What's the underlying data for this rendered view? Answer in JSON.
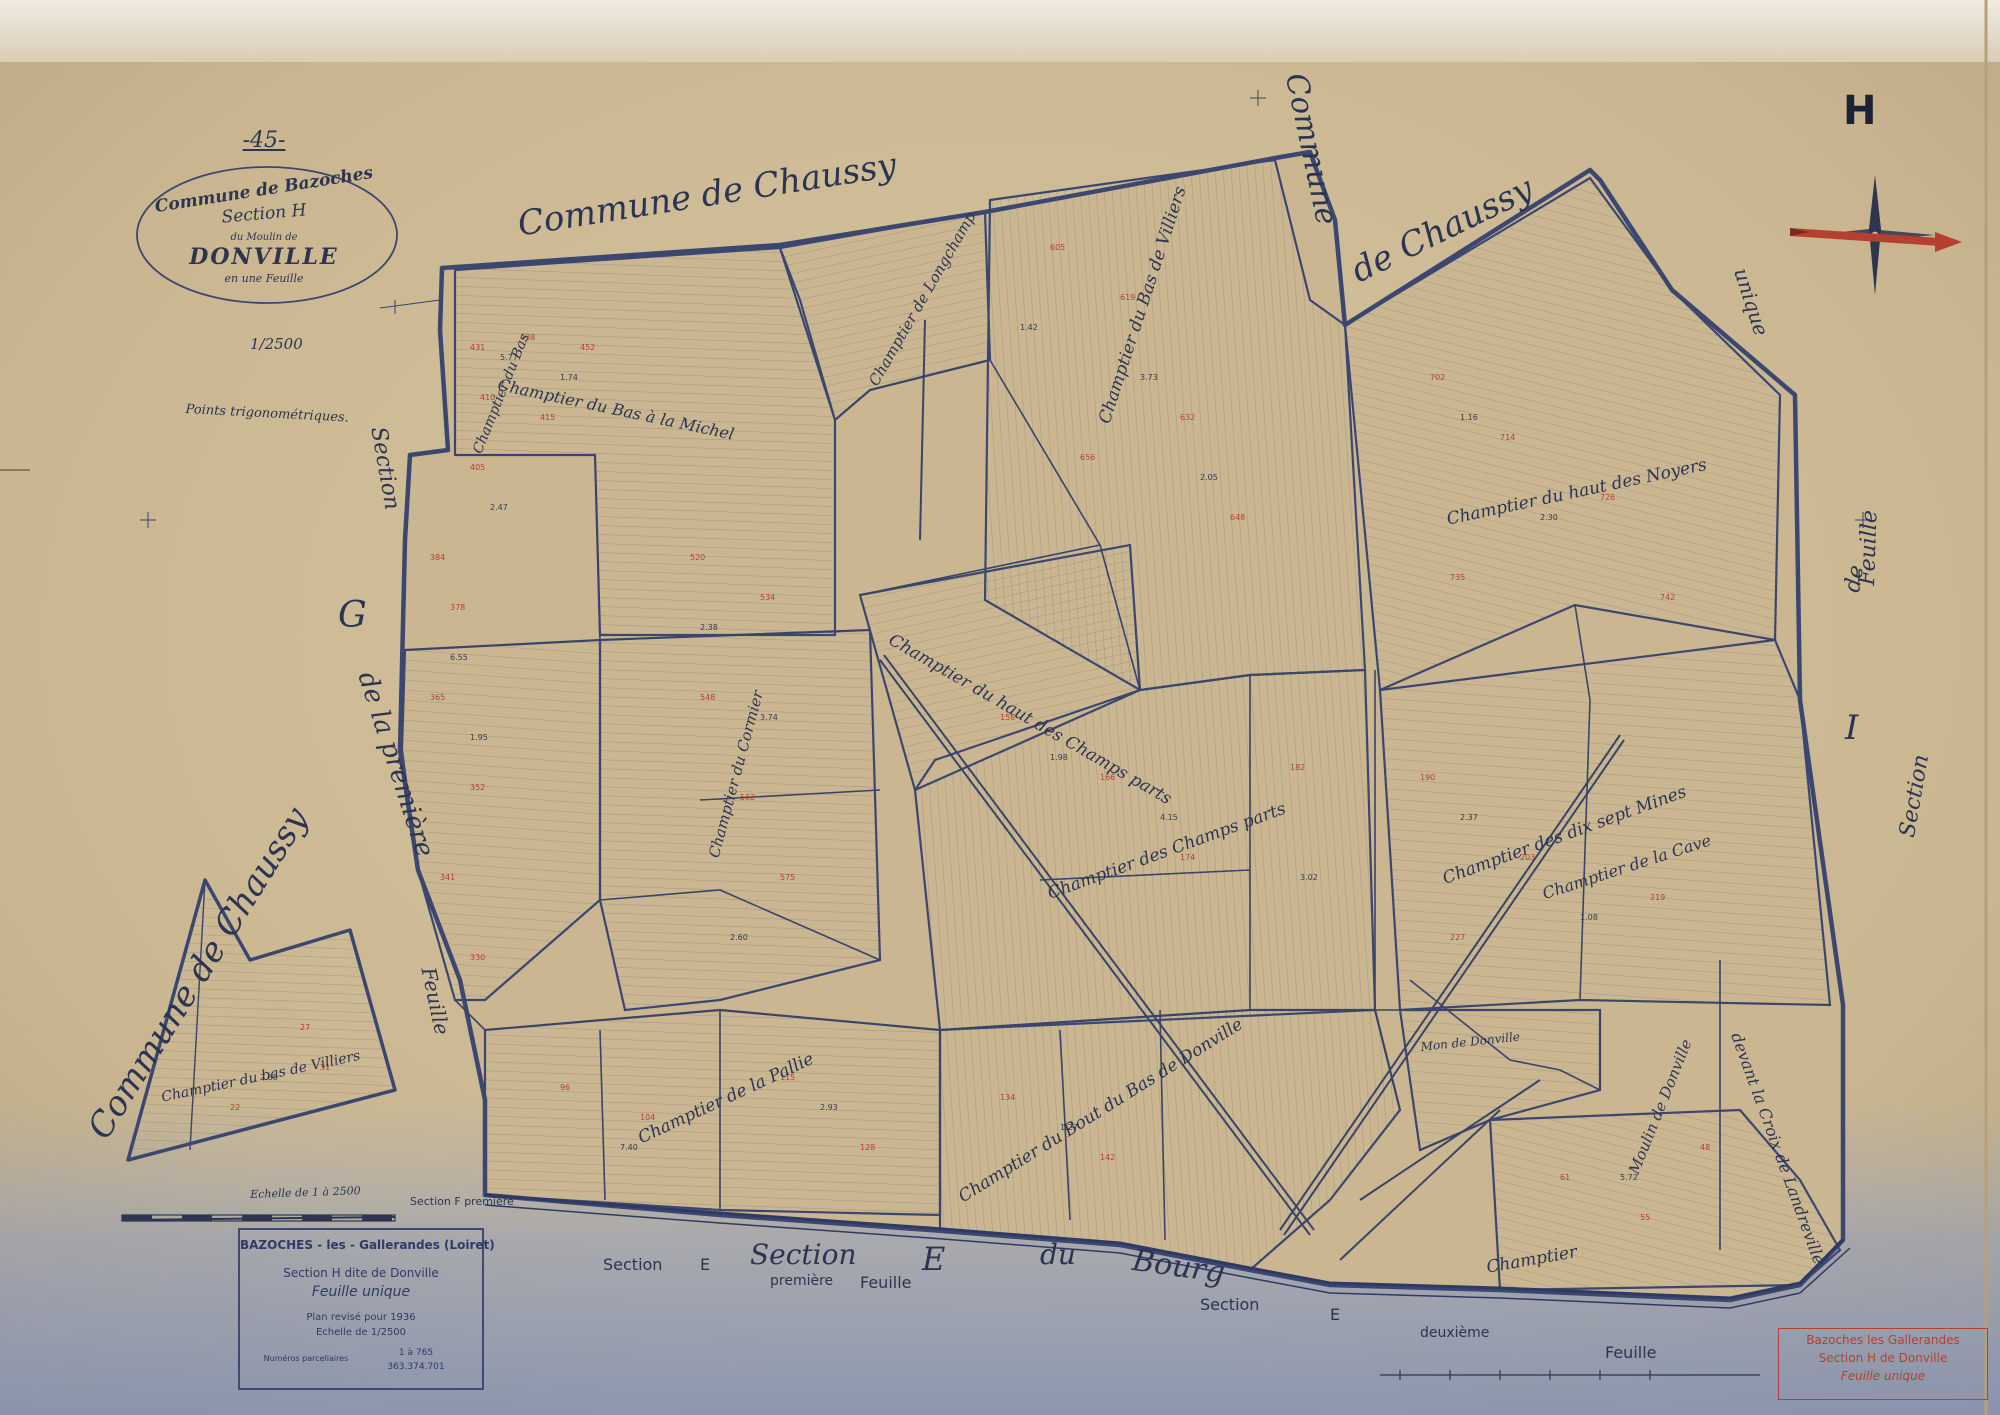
{
  "sheet": {
    "section_letter": "H",
    "sheet_number": "-45-",
    "cartouche": {
      "line1": "Commune de Bazoches",
      "line2": "Section H",
      "line3": "du Moulin de",
      "line4": "DONVILLE",
      "line5": "en une Feuille"
    },
    "scale_fraction": "1/2500",
    "trig_points": "Points trigonométriques."
  },
  "neighbours": {
    "north_left": "Commune de Chaussy",
    "north_vertical": "Commune",
    "north_right": "de Chaussy",
    "west_inset": "Commune de Chaussy",
    "west_section": "Section",
    "west_letter": "G",
    "west_premiere": "de la première",
    "west_feuille": "Feuille",
    "east_section": "Section",
    "east_letter": "I",
    "east_de": "de",
    "east_feuille": "Feuille",
    "east_unique": "unique",
    "south_section_label": "Section",
    "south_letter": "E",
    "south_section_italic": "Section",
    "south_premiere": "première",
    "south_feuille": "Feuille",
    "south_du": "du",
    "south_bourg": "Bourg",
    "south_section2": "Section",
    "south_letter2": "E",
    "south_deuxieme": "deuxième",
    "south_feuille2": "Feuille",
    "scale_bar_label": "Echelle de 1 à 2500",
    "section_f": "Section F première"
  },
  "champtiers": [
    "Champtier du Bas à la Michel",
    "Champtier du Bas",
    "Champtier de Longchamp",
    "Champtier du Bas de Villiers",
    "Champtier du haut des Noyers",
    "Champtier du haut des Champs parts",
    "Champtier du Cormier",
    "Champtier des Champs parts",
    "Champtier des dix sept Mines",
    "Champtier de la Cave",
    "Champtier de la Pallie",
    "Champtier du Bout du Bas de Donville",
    "Champtier du bas de Villiers",
    "Champtier",
    "Mon de Donville",
    "Moulin de Donville",
    "devant la Croix de Landreville"
  ],
  "legend": {
    "title": "BAZOCHES - les - Gallerandes (Loiret)",
    "section": "Section H dite de Donville",
    "feuille": "Feuille unique",
    "plan": "Plan revisé pour 1936",
    "echelle_label": "Echelle de",
    "echelle_value": "1/2500",
    "numeros": "Numéros parcellaires",
    "n1": "1 à 765",
    "n2": "363.374.701"
  },
  "stamp": {
    "line1": "Bazoches les Gallerandes",
    "line2": "Section H de Donville",
    "line3": "Feuille unique"
  },
  "colors": {
    "paper": "#cdbb97",
    "ink": "#2d3550",
    "red_ink": "#b5402f",
    "blue_wash": "#7e8fb8"
  }
}
